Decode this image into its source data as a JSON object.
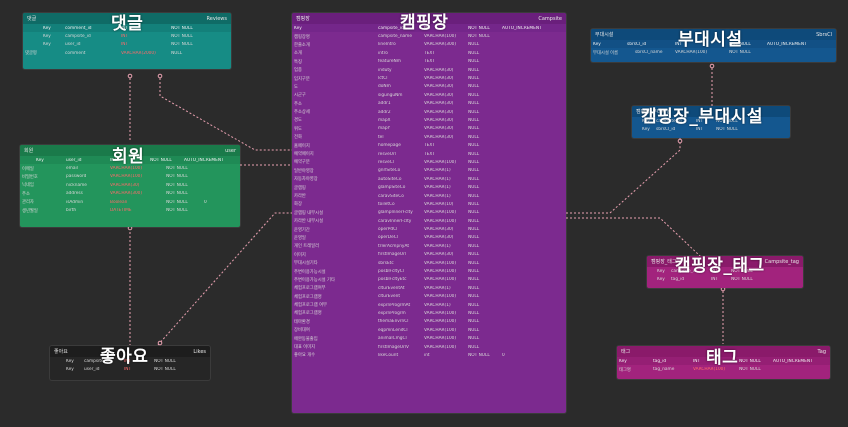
{
  "entities": {
    "comment": {
      "label_ko": "댓글",
      "label_en": "Reviews",
      "big_label": "댓글",
      "color_head": "#0f6b66",
      "color_body": "#168c85",
      "color_col": "#13807a",
      "columns": [
        "Key",
        "comment_id",
        "INT",
        "NOT NULL"
      ],
      "rows": [
        {
          "key": "Key",
          "name": "campsite_id",
          "type": "INT",
          "null": "NOT NULL",
          "label": ""
        },
        {
          "key": "Key",
          "name": "user_id",
          "type": "INT",
          "null": "NOT NULL",
          "label": ""
        },
        {
          "key": "",
          "name": "comment",
          "type": "VARCHAR(2000)",
          "null": "NULL",
          "label": "댓글평"
        }
      ]
    },
    "member": {
      "label_ko": "회원",
      "label_en": "user",
      "big_label": "회원",
      "color_head": "#1a7a4a",
      "color_body": "#23955c",
      "color_col": "#1f8a55",
      "columns": [
        "Key",
        "user_id",
        "INT",
        "NOT NULL",
        "AUTO_INCREMENT"
      ],
      "rows": [
        {
          "key": "",
          "name": "email",
          "type": "VARCHAR(100)",
          "null": "NOT NULL",
          "label": "이메일",
          "extra": ""
        },
        {
          "key": "",
          "name": "password",
          "type": "VARCHAR(100)",
          "null": "NOT NULL",
          "label": "비밀번호",
          "extra": ""
        },
        {
          "key": "",
          "name": "nickname",
          "type": "VARCHAR(30)",
          "null": "NOT NULL",
          "label": "닉네임",
          "extra": ""
        },
        {
          "key": "",
          "name": "address",
          "type": "VARCHAR(300)",
          "null": "NOT NULL",
          "label": "주소",
          "extra": ""
        },
        {
          "key": "",
          "name": "isAdmin",
          "type": "Boolean",
          "null": "NOT NULL",
          "label": "관리자",
          "extra": "0"
        },
        {
          "key": "",
          "name": "birth",
          "type": "DATETIME",
          "null": "NOT NULL",
          "label": "생년월일",
          "extra": ""
        }
      ]
    },
    "likes": {
      "label_ko": "좋아요",
      "label_en": "Likes",
      "big_label": "좋아요",
      "color_head": "#1d1d1d",
      "color_body": "#262626",
      "color_col": "#222222",
      "rows": [
        {
          "key": "Key",
          "name": "campsite_id",
          "type": "INT",
          "null": "NOT NULL",
          "label": ""
        },
        {
          "key": "Key",
          "name": "user_id",
          "type": "INT",
          "null": "NOT NULL",
          "label": ""
        }
      ]
    },
    "campsite": {
      "label_ko": "캠핑장",
      "label_en": "Campsite",
      "big_label": "캠핑장",
      "color_head": "#6a1f7c",
      "color_body": "#7c2a8f",
      "color_col": "#74268a",
      "columns": [
        "Key",
        "campsite_id",
        "INT",
        "NOT NULL",
        "AUTO_INCREMENT"
      ],
      "rows": [
        {
          "label": "캠핑장명",
          "name": "campsite_name",
          "type": "VARCHAR(100)",
          "null": "NOT NULL"
        },
        {
          "label": "한줄소개",
          "name": "lineIntro",
          "type": "VARCHAR(300)",
          "null": "NULL"
        },
        {
          "label": "소개",
          "name": "intro",
          "type": "TEXT",
          "null": "NULL"
        },
        {
          "label": "특징",
          "name": "featureNm",
          "type": "TEXT",
          "null": "NULL"
        },
        {
          "label": "업종",
          "name": "induty",
          "type": "VARCHAR(30)",
          "null": "NULL"
        },
        {
          "label": "입지구분",
          "name": "lctCl",
          "type": "VARCHAR(30)",
          "null": "NULL"
        },
        {
          "label": "도",
          "name": "doNm",
          "type": "VARCHAR(30)",
          "null": "NULL"
        },
        {
          "label": "시군구",
          "name": "sigunguNm",
          "type": "VARCHAR(30)",
          "null": "NULL"
        },
        {
          "label": "주소",
          "name": "addr1",
          "type": "VARCHAR(30)",
          "null": "NULL"
        },
        {
          "label": "주소상세",
          "name": "addr2",
          "type": "VARCHAR(30)",
          "null": "NULL"
        },
        {
          "label": "경도",
          "name": "mapX",
          "type": "VARCHAR(30)",
          "null": "NULL"
        },
        {
          "label": "위도",
          "name": "mapY",
          "type": "VARCHAR(30)",
          "null": "NULL"
        },
        {
          "label": "전화",
          "name": "tel",
          "type": "VARCHAR(30)",
          "null": "NULL"
        },
        {
          "label": "홈페이지",
          "name": "homepage",
          "type": "TEXT",
          "null": "NULL"
        },
        {
          "label": "예약페이지",
          "name": "resveUrl",
          "type": "TEXT",
          "null": "NULL"
        },
        {
          "label": "예약구분",
          "name": "resveCl",
          "type": "VARCHAR(100)",
          "null": "NULL"
        },
        {
          "label": "일반야영장",
          "name": "gnrlSiteCo",
          "type": "VARCHAR(1)",
          "null": "NULL"
        },
        {
          "label": "자동차야영장",
          "name": "autoSiteCo",
          "type": "VARCHAR(1)",
          "null": "NULL"
        },
        {
          "label": "글램핑",
          "name": "glampSiteCo",
          "type": "VARCHAR(1)",
          "null": "NULL"
        },
        {
          "label": "카라반",
          "name": "caravSiteCo",
          "type": "VARCHAR(1)",
          "null": "NULL"
        },
        {
          "label": "화장",
          "name": "toiletCo",
          "type": "VARCHAR(10)",
          "null": "NULL"
        },
        {
          "label": "글램핑 내부시설",
          "name": "glampInnerFclty",
          "type": "VARCHAR(100)",
          "null": "NULL"
        },
        {
          "label": "카라반 내부시설",
          "name": "caravInnerFclty",
          "type": "VARCHAR(100)",
          "null": "NULL"
        },
        {
          "label": "운영기간",
          "name": "operPdCl",
          "type": "VARCHAR(30)",
          "null": "NULL"
        },
        {
          "label": "운영일",
          "name": "operDeCl",
          "type": "VARCHAR(30)",
          "null": "NULL"
        },
        {
          "label": "개인 트레일러",
          "name": "trlerAcmpnyAt",
          "type": "VARCHAR(1)",
          "null": "NULL"
        },
        {
          "label": "이미지",
          "name": "firstImageUrl",
          "type": "VARCHAR(30)",
          "null": "NULL"
        },
        {
          "label": "부대시설기타",
          "name": "sbrsEtc",
          "type": "VARCHAR(100)",
          "null": "NULL"
        },
        {
          "label": "주변이용가능시설",
          "name": "posblFcltyCl",
          "type": "VARCHAR(100)",
          "null": "NULL"
        },
        {
          "label": "주변이용가능시설 기타",
          "name": "posblFcltyEtc",
          "type": "VARCHAR(100)",
          "null": "NULL"
        },
        {
          "label": "체험프로그램여부",
          "name": "clturEventAt",
          "type": "VARCHAR(1)",
          "null": "NULL"
        },
        {
          "label": "체험프로그램명",
          "name": "clturEvent",
          "type": "VARCHAR(100)",
          "null": "NULL"
        },
        {
          "label": "체험프로그램 여부",
          "name": "exprnProgrmAt",
          "type": "VARCHAR(1)",
          "null": "NULL"
        },
        {
          "label": "체험프로그램명",
          "name": "exprnProgrm",
          "type": "VARCHAR(100)",
          "null": "NULL"
        },
        {
          "label": "테마환경",
          "name": "themaEnvrnCl",
          "type": "VARCHAR(100)",
          "null": "NULL"
        },
        {
          "label": "장비대여",
          "name": "eqpmnLendCl",
          "type": "VARCHAR(100)",
          "null": "NULL"
        },
        {
          "label": "애완동물출입",
          "name": "animalCmgCl",
          "type": "VARCHAR(100)",
          "null": "NULL"
        },
        {
          "label": "대표 이미지",
          "name": "firstImageUrlV",
          "type": "VARCHAR(100)",
          "null": "NULL"
        },
        {
          "label": "좋아요 개수",
          "name": "likeCount",
          "type": "int",
          "null": "NOT NULL",
          "extra": "0"
        }
      ]
    },
    "facility": {
      "label_ko": "부대시설",
      "label_en": "SbrsCl",
      "big_label": "부대시설",
      "color_head": "#0e4a7a",
      "color_body": "#14578f",
      "color_col": "#125085",
      "columns": [
        "Key",
        "sbrsCl_id",
        "INT",
        "NOT NULL",
        "AUTO_INCREMENT"
      ],
      "rows": [
        {
          "label": "부대시설 이름",
          "name": "sbrsCl_name",
          "type": "VARCHAR(100)",
          "null": "NOT NULL"
        }
      ]
    },
    "campsite_facility": {
      "label_ko": "캠핑장_부대시설",
      "label_en": "",
      "big_label": "캠핑장_부대시설",
      "color_head": "#0e4a7a",
      "color_body": "#14578f",
      "color_col": "#125085",
      "rows": [
        {
          "key": "Key",
          "name": "campsite_id",
          "type": "INT",
          "null": "NOT NULL"
        },
        {
          "key": "Key",
          "name": "sbrsCl_id",
          "type": "INT",
          "null": "NOT NULL"
        }
      ]
    },
    "campsite_tag": {
      "label_ko": "캠핑장_태그",
      "label_en": "Campsite_tag",
      "big_label": "캠핑장_태그",
      "color_head": "#8a1a6a",
      "color_body": "#a2237d",
      "color_col": "#951f74",
      "rows": [
        {
          "key": "Key",
          "name": "campsite_id",
          "type": "INT",
          "null": "NOT NULL"
        },
        {
          "key": "Key",
          "name": "tag_id",
          "type": "INT",
          "null": "NOT NULL"
        }
      ]
    },
    "tag": {
      "label_ko": "태그",
      "label_en": "Tag",
      "big_label": "태그",
      "color_head": "#8a1a6a",
      "color_body": "#a2237d",
      "color_col": "#951f74",
      "columns": [
        "Key",
        "tag_id",
        "INT",
        "NOT NULL",
        "AUTO_INCREMENT"
      ],
      "rows": [
        {
          "label": "태그명",
          "name": "tag_name",
          "type": "VARCHAR(100)",
          "null": "NOT NULL"
        }
      ]
    }
  },
  "link_color": "#e8a0b0"
}
